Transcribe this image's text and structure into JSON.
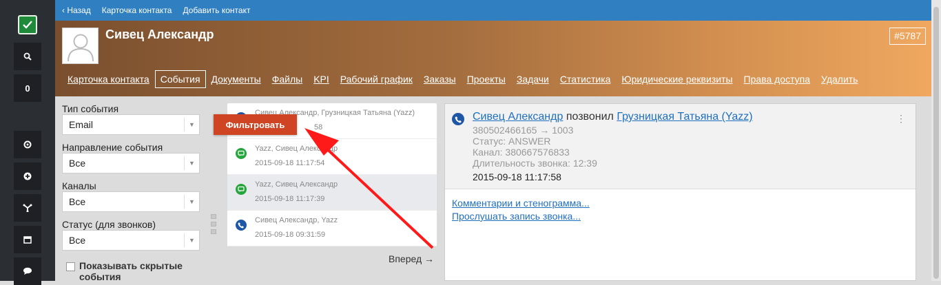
{
  "sidebar": {
    "counter": "0",
    "icons": [
      "logo-check-icon",
      "search-icon",
      "lifebuoy-icon",
      "plus-circle-icon",
      "fork-icon",
      "calendar-icon",
      "chat-icon"
    ],
    "colors": {
      "bg": "#2b2e33",
      "logo": "#1f8a3a"
    }
  },
  "topbar": {
    "back": "‹ Назад",
    "card": "Карточка контакта",
    "add": "Добавить контакт"
  },
  "header": {
    "name": "Сивец Александр",
    "id": "#5787",
    "tabs": [
      "Карточка контакта",
      "События",
      "Документы",
      "Файлы",
      "KPI",
      "Рабочий график",
      "Заказы",
      "Проекты",
      "Задачи",
      "Статистика",
      "Юридические реквизиты",
      "Права доступа",
      "Удалить"
    ],
    "active_tab": "События"
  },
  "filters": {
    "event_type_label": "Тип события",
    "event_type_value": "Email",
    "direction_label": "Направление события",
    "direction_value": "Все",
    "channels_label": "Каналы",
    "channels_value": "Все",
    "status_label": "Статус (для звонков)",
    "status_value": "Все",
    "show_hidden": "Показывать скрытые события",
    "filter_button": "Фильтровать"
  },
  "events": [
    {
      "icon": "phone-icon",
      "who": "Сивец Александр, Грузницкая Татьяна (Yazz)",
      "time": "58"
    },
    {
      "icon": "chat-icon",
      "who": "Yazz, Сивец Александр",
      "time": "2015-09-18 11:17:54"
    },
    {
      "icon": "chat-icon",
      "who": "Yazz, Сивец Александр",
      "time": "2015-09-18 11:17:39"
    },
    {
      "icon": "phone-icon",
      "who": "Сивец Александр, Yazz",
      "time": "2015-09-18 09:31:59"
    }
  ],
  "forward": "Вперед →",
  "detail": {
    "caller": "Сивец Александр",
    "verb": " позвонил ",
    "callee": "Грузницкая Татьяна (Yazz)",
    "numbers": "380502466165 → 1003",
    "status": "Статус: ANSWER",
    "channel": "Канал: 380667576833",
    "duration": "Длительность звонка: 12:39",
    "date": "2015-09-18 11:17:58",
    "comments_link": "Комментарии и стенограмма...",
    "listen_link": "Прослушать запись звонка..."
  },
  "annotation": {
    "color": "#ff1a1a"
  }
}
